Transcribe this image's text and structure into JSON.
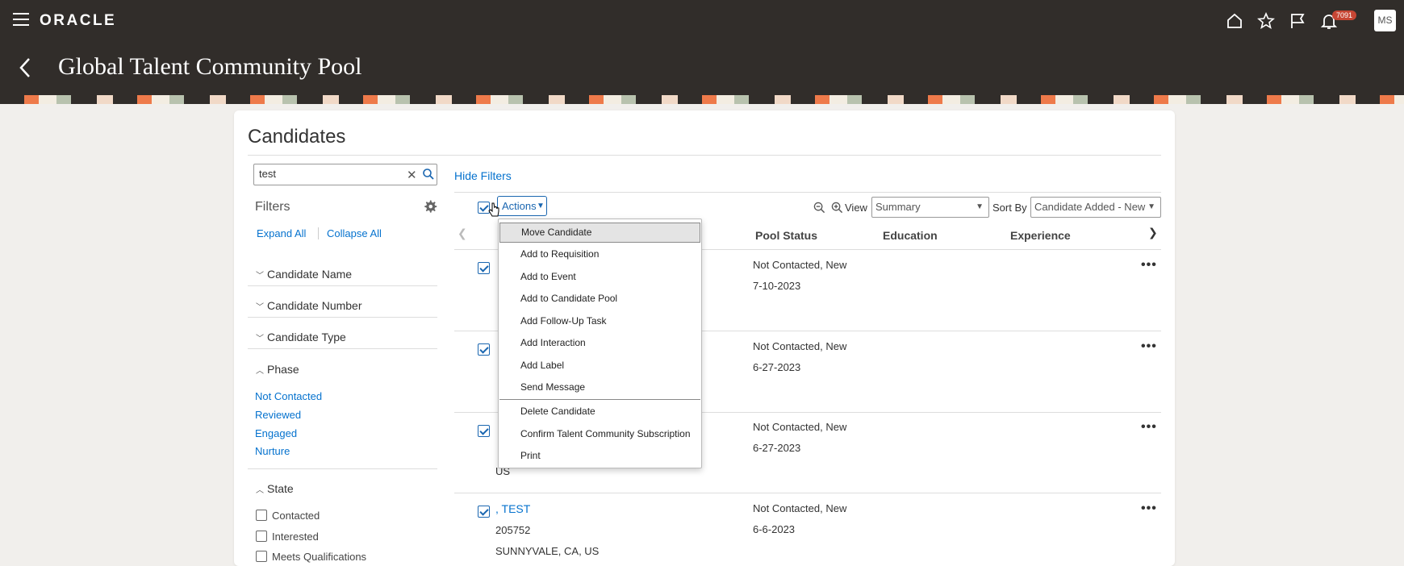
{
  "app": {
    "brand": "ORACLE",
    "notification_count": "7091",
    "user_initials": "MS",
    "page_title": "Global Talent Community Pool"
  },
  "section": {
    "title": "Candidates"
  },
  "search": {
    "value": "test"
  },
  "filters": {
    "hide_filters_label": "Hide Filters",
    "title": "Filters",
    "expand_all": "Expand All",
    "collapse_all": "Collapse All",
    "groups": [
      {
        "label": "Candidate Name",
        "expanded": false
      },
      {
        "label": "Candidate Number",
        "expanded": false
      },
      {
        "label": "Candidate Type",
        "expanded": false
      },
      {
        "label": "Phase",
        "expanded": true
      },
      {
        "label": "State",
        "expanded": true
      }
    ],
    "phase_links": [
      "Not Contacted",
      "Reviewed",
      "Engaged",
      "Nurture"
    ],
    "state_options": [
      "Contacted",
      "Interested",
      "Meets Qualifications"
    ]
  },
  "toolbar": {
    "actions_label": "Actions",
    "view_label": "View",
    "view_value": "Summary",
    "sort_label": "Sort By",
    "sort_value": "Candidate Added - New"
  },
  "table": {
    "columns": [
      "Pool Status",
      "Education",
      "Experience"
    ],
    "rows": [
      {
        "status": "Not Contacted, New",
        "date": "7-10-2023"
      },
      {
        "status": "Not Contacted, New",
        "date": "6-27-2023"
      },
      {
        "status": "Not Contacted, New",
        "date": "6-27-2023",
        "location_partial": "US"
      },
      {
        "status": "Not Contacted, New",
        "date": "6-6-2023",
        "name": ", TEST",
        "number": "205752",
        "location": "SUNNYVALE, CA, US"
      }
    ]
  },
  "actions_menu": {
    "items": [
      "Move Candidate",
      "Add to Requisition",
      "Add to Event",
      "Add to Candidate Pool",
      "Add Follow-Up Task",
      "Add Interaction",
      "Add Label",
      "Send Message",
      "Delete Candidate",
      "Confirm Talent Community Subscription",
      "Print"
    ],
    "highlighted": "Move Candidate"
  },
  "colors": {
    "header_bg": "#312d2a",
    "link": "#0572ce",
    "badge": "#c74634"
  }
}
